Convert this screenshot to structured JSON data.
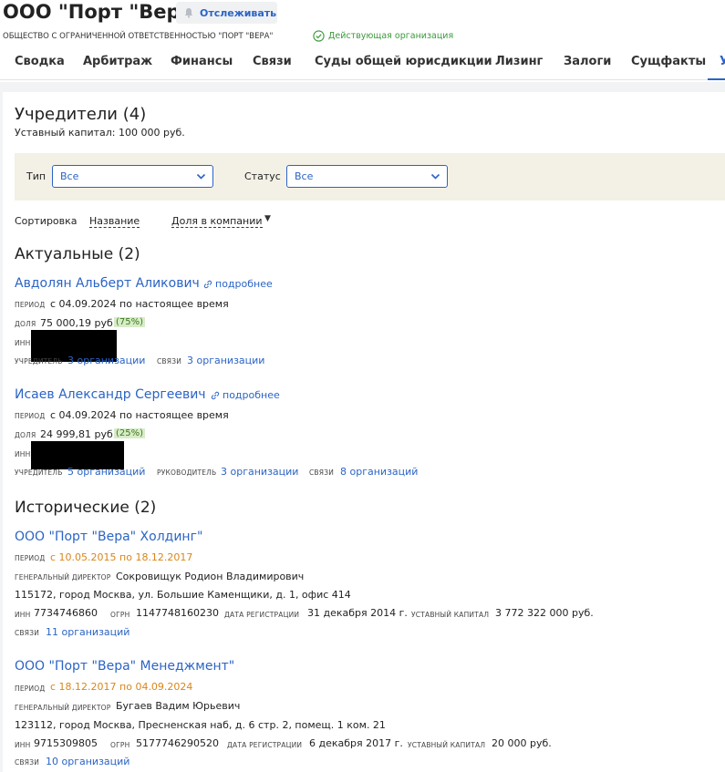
{
  "header": {
    "title": "ООО \"Порт \"Вера\"",
    "track_label": "Отслеживать",
    "subtitle": "ОБЩЕСТВО С ОГРАНИЧЕННОЙ ОТВЕТСТВЕННОСТЬЮ \"ПОРТ \"ВЕРА\"",
    "status": "Действующая организация",
    "status_color": "#3a9a3a"
  },
  "tabs": [
    {
      "label": "Сводка"
    },
    {
      "label": "Арбитраж"
    },
    {
      "label": "Финансы"
    },
    {
      "label": "Связи"
    },
    {
      "label": "Суды общей юрисдикции"
    },
    {
      "label": "Лизинг"
    },
    {
      "label": "Залоги"
    },
    {
      "label": "Сущфакты"
    },
    {
      "label": "У"
    }
  ],
  "section": {
    "title": "Учредители (4)",
    "capital": "Уставный капитал: 100 000 руб."
  },
  "filters": {
    "type_label": "Тип",
    "type_value": "Все",
    "status_label": "Статус",
    "status_value": "Все"
  },
  "sort": {
    "label": "Сортировка",
    "by_name": "Название",
    "by_share": "Доля в компании"
  },
  "current": {
    "title": "Актуальные (2)",
    "items": [
      {
        "name": "Авдолян Альберт Аликович",
        "more": "подробнее",
        "period_label": "ПЕРИОД",
        "period": "с 04.09.2024 по настоящее время",
        "share_label": "ДОЛЯ",
        "share": "75 000,19 руб.",
        "share_pct": "(75%)",
        "inn_label": "ИНН",
        "founder_label": "УЧРЕДИТЕЛЬ",
        "founder_link": "3 организации",
        "links_label": "СВЯЗИ",
        "links_link": "3 организации"
      },
      {
        "name": "Исаев Александр Сергеевич",
        "more": "подробнее",
        "period_label": "ПЕРИОД",
        "period": "с 04.09.2024 по настоящее время",
        "share_label": "ДОЛЯ",
        "share": "24 999,81 руб.",
        "share_pct": "(25%)",
        "inn_label": "ИНН",
        "founder_label": "УЧРЕДИТЕЛЬ",
        "founder_link": "5 организаций",
        "head_label": "РУКОВОДИТЕЛЬ",
        "head_link": "3 организации",
        "links_label": "СВЯЗИ",
        "links_link": "8 организаций"
      }
    ]
  },
  "historic": {
    "title": "Исторические (2)",
    "items": [
      {
        "name": "ООО \"Порт \"Вера\" Холдинг\"",
        "period_label": "ПЕРИОД",
        "period": "с 10.05.2015 по 18.12.2017",
        "director_label": "ГЕНЕРАЛЬНЫЙ ДИРЕКТОР",
        "director": "Сокровищук Родион Владимирович",
        "address": "115172, город Москва, ул. Большие Каменщики, д. 1, офис 414",
        "inn_label": "ИНН",
        "inn": "7734746860",
        "ogrn_label": "ОГРН",
        "ogrn": "1147748160230",
        "reg_label": "ДАТА РЕГИСТРАЦИИ",
        "reg": "31 декабря 2014 г.",
        "cap_label": "УСТАВНЫЙ КАПИТАЛ",
        "cap": "3 772 322 000 руб.",
        "links_label": "СВЯЗИ",
        "links_link": "11 организаций"
      },
      {
        "name": "ООО \"Порт \"Вера\" Менеджмент\"",
        "period_label": "ПЕРИОД",
        "period": "с 18.12.2017 по 04.09.2024",
        "director_label": "ГЕНЕРАЛЬНЫЙ ДИРЕКТОР",
        "director": "Бугаев Вадим Юрьевич",
        "address": "123112, город Москва, Пресненская наб, д. 6 стр. 2, помещ. 1 ком. 21",
        "inn_label": "ИНН",
        "inn": "9715309805",
        "ogrn_label": "ОГРН",
        "ogrn": "5177746290520",
        "reg_label": "ДАТА РЕГИСТРАЦИИ",
        "reg": "6 декабря 2017 г.",
        "cap_label": "УСТАВНЫЙ КАПИТАЛ",
        "cap": "20 000 руб.",
        "links_label": "СВЯЗИ",
        "links_link": "10 организаций"
      }
    ]
  },
  "colors": {
    "accent": "#2b64c5",
    "period_orange": "#d9861a",
    "filter_bg": "#f3f1e6"
  }
}
